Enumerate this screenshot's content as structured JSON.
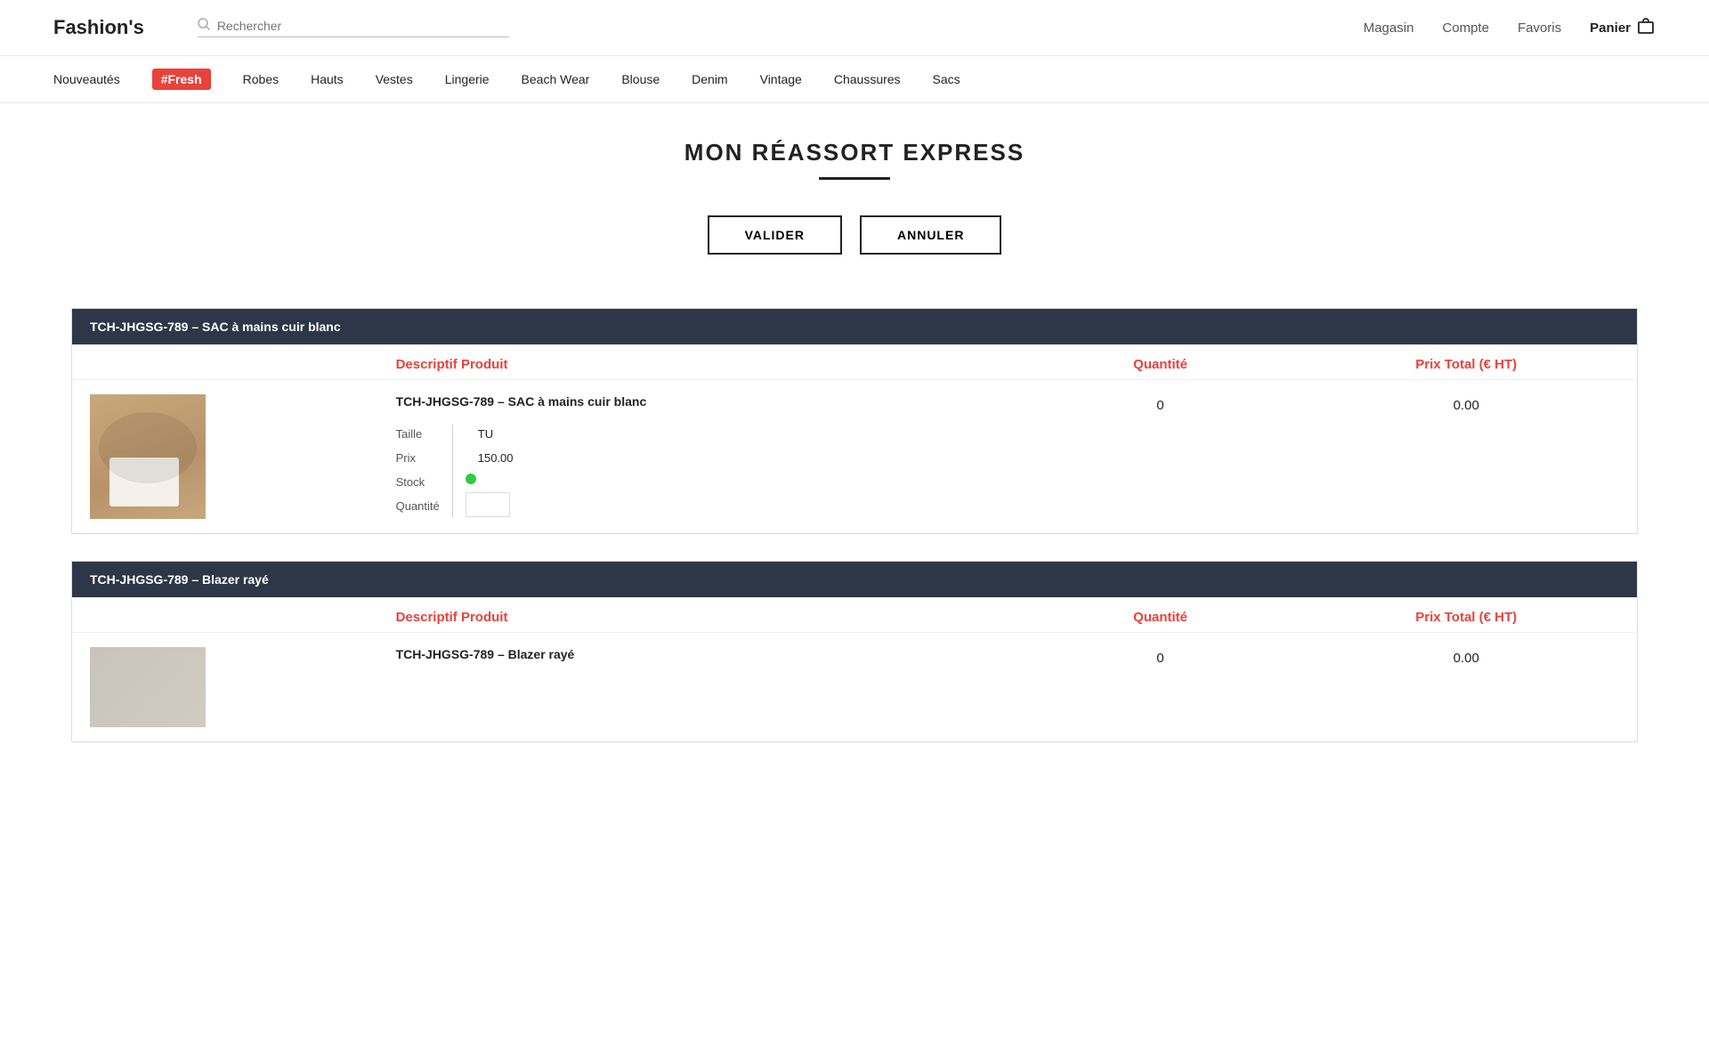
{
  "header": {
    "logo": "Fashion's",
    "search_placeholder": "Rechercher",
    "nav_items": [
      {
        "label": "Magasin",
        "id": "magasin"
      },
      {
        "label": "Compte",
        "id": "compte"
      },
      {
        "label": "Favoris",
        "id": "favoris"
      },
      {
        "label": "Panier",
        "id": "panier"
      }
    ]
  },
  "nav_categories": [
    {
      "label": "Nouveautés",
      "id": "nouveautes",
      "type": "text"
    },
    {
      "label": "#Fresh",
      "id": "fresh",
      "type": "badge"
    },
    {
      "label": "Robes",
      "id": "robes",
      "type": "text"
    },
    {
      "label": "Hauts",
      "id": "hauts",
      "type": "text"
    },
    {
      "label": "Vestes",
      "id": "vestes",
      "type": "text"
    },
    {
      "label": "Lingerie",
      "id": "lingerie",
      "type": "text"
    },
    {
      "label": "Beach Wear",
      "id": "beachwear",
      "type": "text"
    },
    {
      "label": "Blouse",
      "id": "blouse",
      "type": "text"
    },
    {
      "label": "Denim",
      "id": "denim",
      "type": "text"
    },
    {
      "label": "Vintage",
      "id": "vintage",
      "type": "text"
    },
    {
      "label": "Chaussures",
      "id": "chaussures",
      "type": "text"
    },
    {
      "label": "Sacs",
      "id": "sacs",
      "type": "text"
    }
  ],
  "page": {
    "title": "MON RÉASSORT EXPRESS",
    "valider_label": "VALIDER",
    "annuler_label": "ANNULER"
  },
  "columns": {
    "descriptif": "Descriptif Produit",
    "quantite": "Quantité",
    "prix": "Prix Total (€ HT)"
  },
  "products": [
    {
      "id": "product-1",
      "section_title": "TCH-JHGSG-789 – SAC à mains cuir blanc",
      "name": "TCH-JHGSG-789 – SAC à mains cuir blanc",
      "quantity": "0",
      "price": "0.00",
      "details": [
        {
          "label": "Taille",
          "value": "TU"
        },
        {
          "label": "Prix",
          "value": "150.00"
        },
        {
          "label": "Stock",
          "value": "stock_green"
        },
        {
          "label": "Quantité",
          "value": ""
        }
      ]
    },
    {
      "id": "product-2",
      "section_title": "TCH-JHGSG-789 – Blazer rayé",
      "name": "TCH-JHGSG-789 – Blazer rayé",
      "quantity": "0",
      "price": "0.00",
      "details": []
    }
  ]
}
